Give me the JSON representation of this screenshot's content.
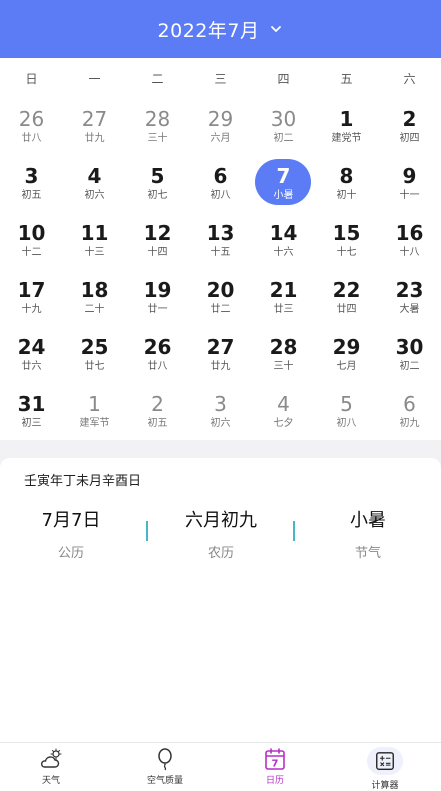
{
  "header": {
    "title": "2022年7月"
  },
  "weekdays": [
    "日",
    "一",
    "二",
    "三",
    "四",
    "五",
    "六"
  ],
  "days": [
    {
      "d": "26",
      "l": "廿八",
      "other": true
    },
    {
      "d": "27",
      "l": "廿九",
      "other": true
    },
    {
      "d": "28",
      "l": "三十",
      "other": true
    },
    {
      "d": "29",
      "l": "六月",
      "other": true
    },
    {
      "d": "30",
      "l": "初二",
      "other": true
    },
    {
      "d": "1",
      "l": "建党节"
    },
    {
      "d": "2",
      "l": "初四"
    },
    {
      "d": "3",
      "l": "初五"
    },
    {
      "d": "4",
      "l": "初六"
    },
    {
      "d": "5",
      "l": "初七"
    },
    {
      "d": "6",
      "l": "初八"
    },
    {
      "d": "7",
      "l": "小暑",
      "selected": true
    },
    {
      "d": "8",
      "l": "初十"
    },
    {
      "d": "9",
      "l": "十一"
    },
    {
      "d": "10",
      "l": "十二"
    },
    {
      "d": "11",
      "l": "十三"
    },
    {
      "d": "12",
      "l": "十四"
    },
    {
      "d": "13",
      "l": "十五"
    },
    {
      "d": "14",
      "l": "十六"
    },
    {
      "d": "15",
      "l": "十七"
    },
    {
      "d": "16",
      "l": "十八"
    },
    {
      "d": "17",
      "l": "十九"
    },
    {
      "d": "18",
      "l": "二十"
    },
    {
      "d": "19",
      "l": "廿一"
    },
    {
      "d": "20",
      "l": "廿二"
    },
    {
      "d": "21",
      "l": "廿三"
    },
    {
      "d": "22",
      "l": "廿四"
    },
    {
      "d": "23",
      "l": "大暑"
    },
    {
      "d": "24",
      "l": "廿六"
    },
    {
      "d": "25",
      "l": "廿七"
    },
    {
      "d": "26",
      "l": "廿八"
    },
    {
      "d": "27",
      "l": "廿九"
    },
    {
      "d": "28",
      "l": "三十"
    },
    {
      "d": "29",
      "l": "七月"
    },
    {
      "d": "30",
      "l": "初二"
    },
    {
      "d": "31",
      "l": "初三"
    },
    {
      "d": "1",
      "l": "建军节",
      "other": true
    },
    {
      "d": "2",
      "l": "初五",
      "other": true
    },
    {
      "d": "3",
      "l": "初六",
      "other": true
    },
    {
      "d": "4",
      "l": "七夕",
      "other": true
    },
    {
      "d": "5",
      "l": "初八",
      "other": true
    },
    {
      "d": "6",
      "l": "初九",
      "other": true
    }
  ],
  "info": {
    "ganzhi": "壬寅年丁未月辛酉日",
    "solar_value": "7月7日",
    "solar_label": "公历",
    "lunar_value": "六月初九",
    "lunar_label": "农历",
    "term_value": "小暑",
    "term_label": "节气"
  },
  "tabs": {
    "weather": "天气",
    "air": "空气质量",
    "calendar": "日历",
    "calendar_icon_number": "7",
    "calculator": "计算器"
  },
  "colors": {
    "accent": "#5b7cf5",
    "active_tab": "#b82ec8",
    "separator": "#45b8c8"
  }
}
